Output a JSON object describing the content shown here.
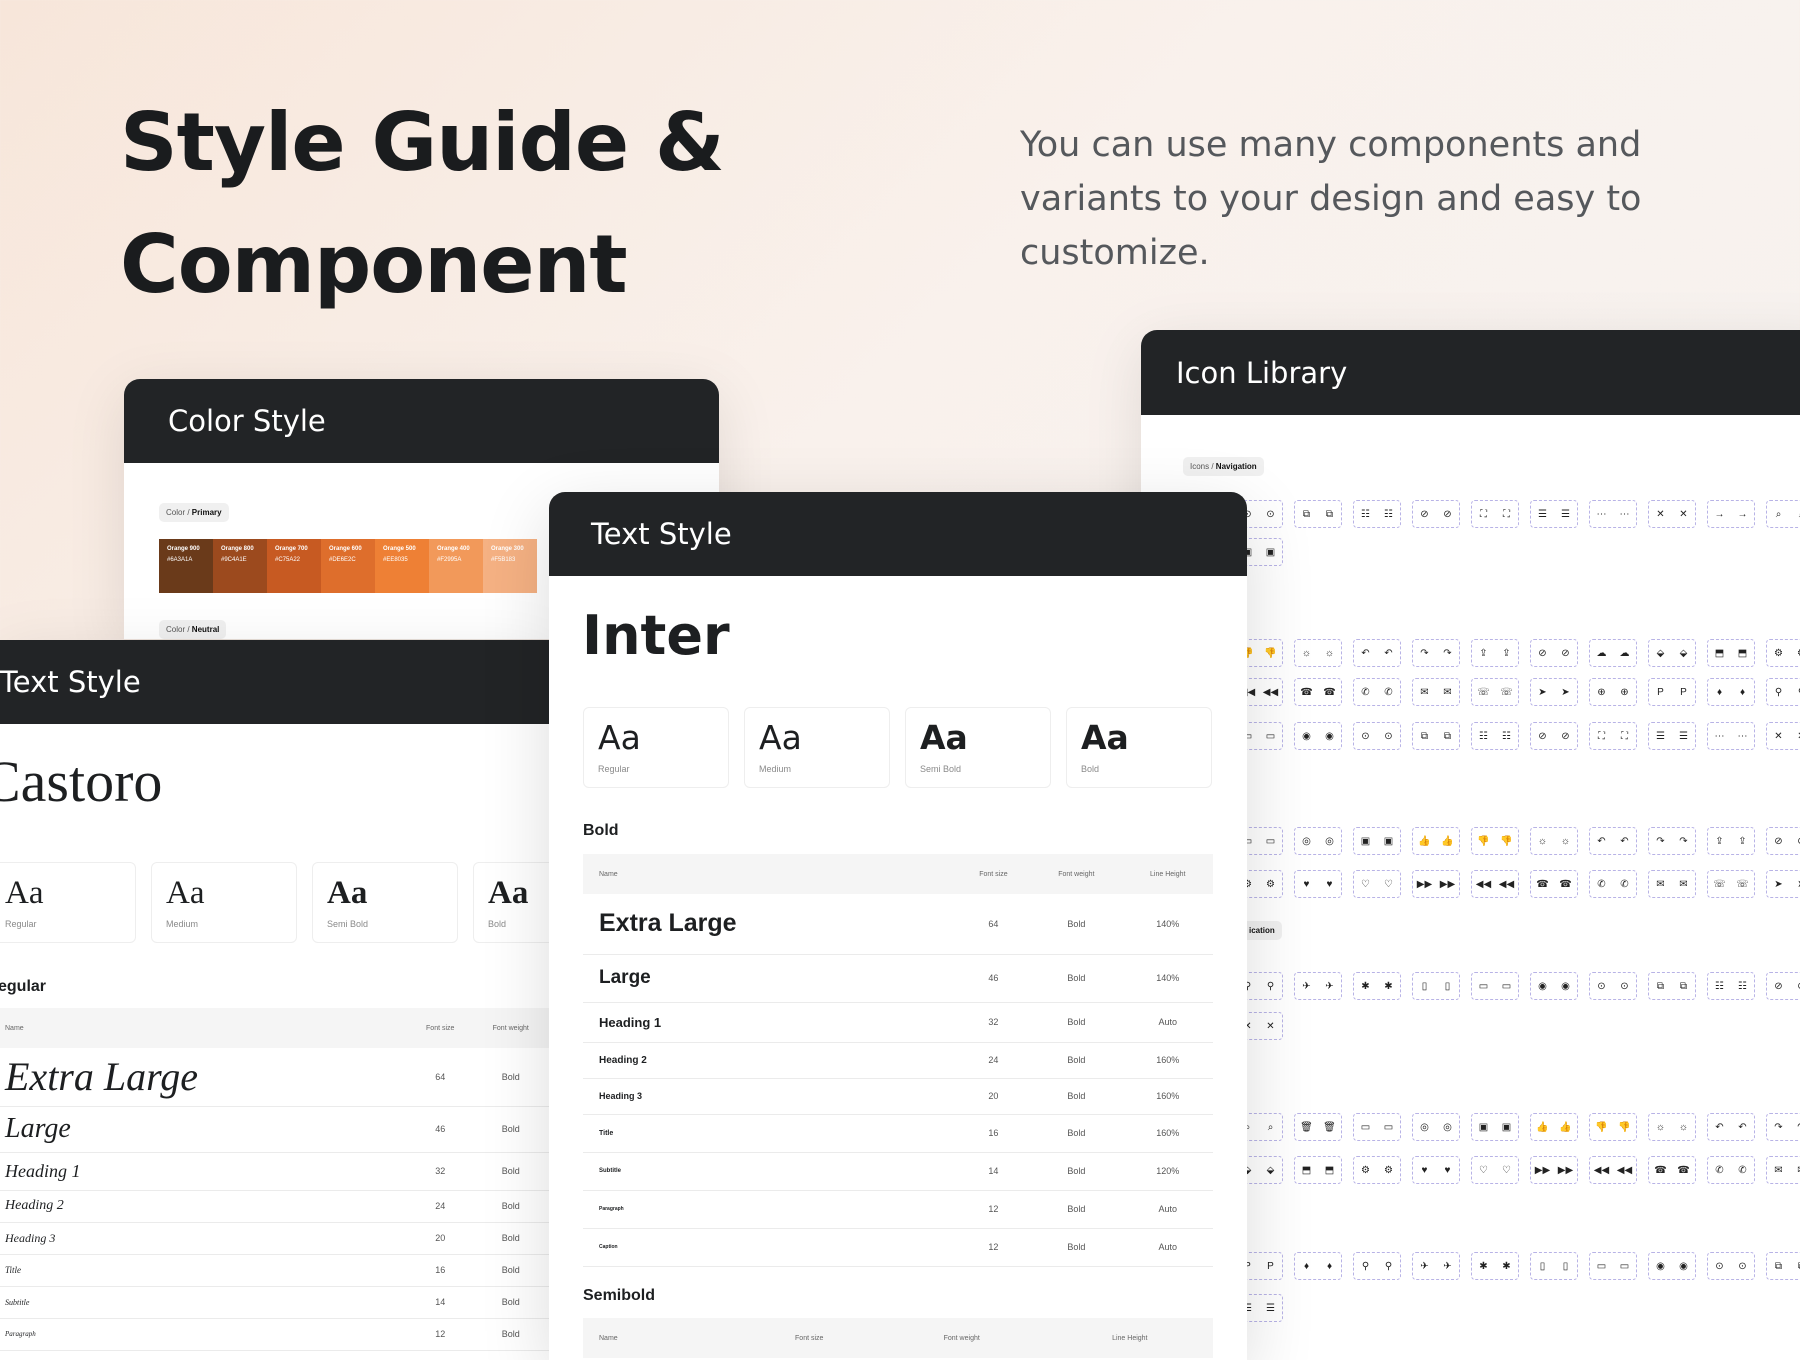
{
  "hero": {
    "title_line1": "Style Guide &",
    "title_line2": "Component",
    "description": "You can use many components and variants to your design and easy to customize."
  },
  "color_card": {
    "title": "Color Style",
    "primary_prefix": "Color / ",
    "primary_label": "Primary",
    "neutral_prefix": "Color / ",
    "neutral_label": "Neutral",
    "swatches": [
      {
        "name": "Orange 900",
        "hex": "#6A3A1A",
        "color": "#6a3a1a"
      },
      {
        "name": "Orange 800",
        "hex": "#9C4A1E",
        "color": "#9c4a1e"
      },
      {
        "name": "Orange 700",
        "hex": "#C75A22",
        "color": "#c75a22"
      },
      {
        "name": "Orange 600",
        "hex": "#DE6E2C",
        "color": "#de6e2c"
      },
      {
        "name": "Orange 500",
        "hex": "#EE8035",
        "color": "#ee8035"
      },
      {
        "name": "Orange 400",
        "hex": "#F2995A",
        "color": "#f2995a"
      },
      {
        "name": "Orange 300",
        "hex": "#F5B183",
        "color": "#f5b183"
      }
    ]
  },
  "castoro_card": {
    "title": "Text Style",
    "font_name": "Castoro",
    "weights": [
      "Regular",
      "Medium",
      "Semi Bold",
      "Bold"
    ],
    "glyph": "Aa",
    "section": "egular",
    "headers": [
      "Name",
      "Font size",
      "Font weight"
    ],
    "rows": [
      {
        "name": "Extra Large",
        "size": "64",
        "weight": "Bold"
      },
      {
        "name": "Large",
        "size": "46",
        "weight": "Bold"
      },
      {
        "name": "Heading 1",
        "size": "32",
        "weight": "Bold"
      },
      {
        "name": "Heading 2",
        "size": "24",
        "weight": "Bold"
      },
      {
        "name": "Heading 3",
        "size": "20",
        "weight": "Bold"
      },
      {
        "name": "Title",
        "size": "16",
        "weight": "Bold"
      },
      {
        "name": "Subtitle",
        "size": "14",
        "weight": "Bold"
      },
      {
        "name": "Paragraph",
        "size": "12",
        "weight": "Bold"
      }
    ]
  },
  "inter_card": {
    "title": "Text Style",
    "font_name": "Inter",
    "weights": [
      "Regular",
      "Medium",
      "Semi Bold",
      "Bold"
    ],
    "glyph": "Aa",
    "section_bold": "Bold",
    "section_semibold": "Semibold",
    "headers": [
      "Name",
      "Font size",
      "Font weight",
      "Line Height"
    ],
    "rows": [
      {
        "name": "Extra Large",
        "size": "64",
        "weight": "Bold",
        "line": "140%"
      },
      {
        "name": "Large",
        "size": "46",
        "weight": "Bold",
        "line": "140%"
      },
      {
        "name": "Heading 1",
        "size": "32",
        "weight": "Bold",
        "line": "Auto"
      },
      {
        "name": "Heading 2",
        "size": "24",
        "weight": "Bold",
        "line": "160%"
      },
      {
        "name": "Heading 3",
        "size": "20",
        "weight": "Bold",
        "line": "160%"
      },
      {
        "name": "Title",
        "size": "16",
        "weight": "Bold",
        "line": "160%"
      },
      {
        "name": "Subtitle",
        "size": "14",
        "weight": "Bold",
        "line": "120%"
      },
      {
        "name": "Paragraph",
        "size": "12",
        "weight": "Bold",
        "line": "Auto"
      },
      {
        "name": "Caption",
        "size": "12",
        "weight": "Bold",
        "line": "Auto"
      }
    ]
  },
  "icon_card": {
    "title": "Icon Library",
    "nav_prefix": "Icons / ",
    "nav_label": "Navigation",
    "comm_label": "ication",
    "icon_glyphs": [
      "◉",
      "⊙",
      "⧉",
      "☷",
      "⊘",
      "⛶",
      "☰",
      "⋯",
      "✕",
      "→",
      "⌕",
      "🗑",
      "▭",
      "◎",
      "▣",
      "👍",
      "👎",
      "☼",
      "↶",
      "↷",
      "⇪",
      "⊘",
      "☁",
      "⬙",
      "⬒",
      "⚙",
      "♥",
      "♡",
      "▶▶",
      "◀◀",
      "☎",
      "✆",
      "✉",
      "☏",
      "➤",
      "⊕",
      "P",
      "♦",
      "⚲",
      "✈",
      "✱",
      "▯",
      "▭"
    ]
  }
}
